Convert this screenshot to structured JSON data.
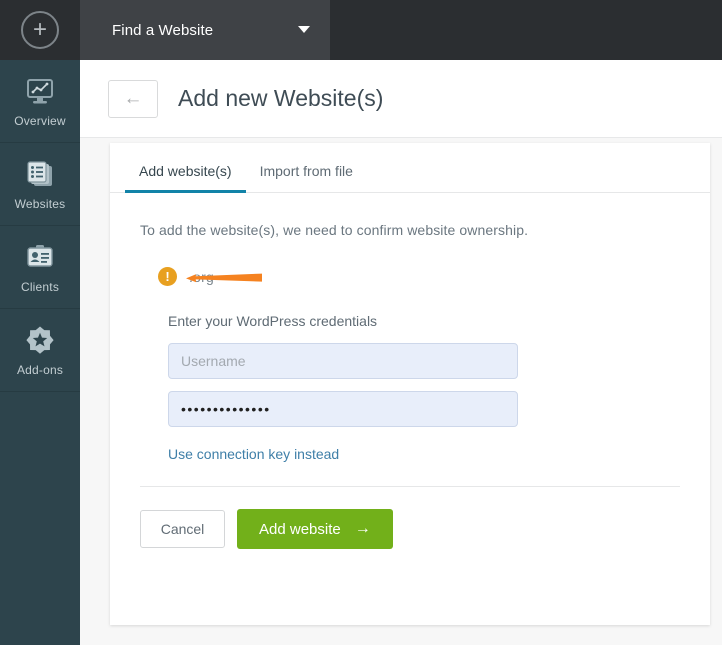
{
  "topbar": {
    "add_button_glyph": "+",
    "add_button_name": "plus-icon",
    "site_selector_label": "Find a Website",
    "caret_icon": "chevron-down-icon",
    "bar_color": "#2b2e31",
    "selector_color": "#3f4246"
  },
  "sidebar": {
    "background": "#2d444c",
    "items": [
      {
        "label": "Overview",
        "icon": "monitor-chart-icon"
      },
      {
        "label": "Websites",
        "icon": "stacked-list-icon"
      },
      {
        "label": "Clients",
        "icon": "id-card-icon"
      },
      {
        "label": "Add-ons",
        "icon": "star-badge-icon"
      }
    ]
  },
  "page": {
    "back_icon": "back-arrow-icon",
    "back_glyph": "←",
    "title": "Add new Website(s)"
  },
  "card": {
    "tabs": [
      {
        "label": "Add website(s)",
        "active": true
      },
      {
        "label": "Import from file",
        "active": false
      }
    ],
    "active_tab_color": "#1283a8",
    "intro": "To add the website(s), we need to confirm website ownership.",
    "site": {
      "warning_icon": "warning-exclamation-icon",
      "warning_glyph": "!",
      "warning_color": "#e8a020",
      "name": ".org",
      "redacted": true,
      "redaction_color": "#f58220"
    },
    "credentials": {
      "heading": "Enter your WordPress credentials",
      "username_placeholder": "Username",
      "username_value": "",
      "password_value": "••••••••••••••",
      "alt_link": "Use connection key instead"
    },
    "actions": {
      "cancel_label": "Cancel",
      "submit_label": "Add website",
      "submit_arrow": "→",
      "submit_color": "#72b01a"
    }
  }
}
